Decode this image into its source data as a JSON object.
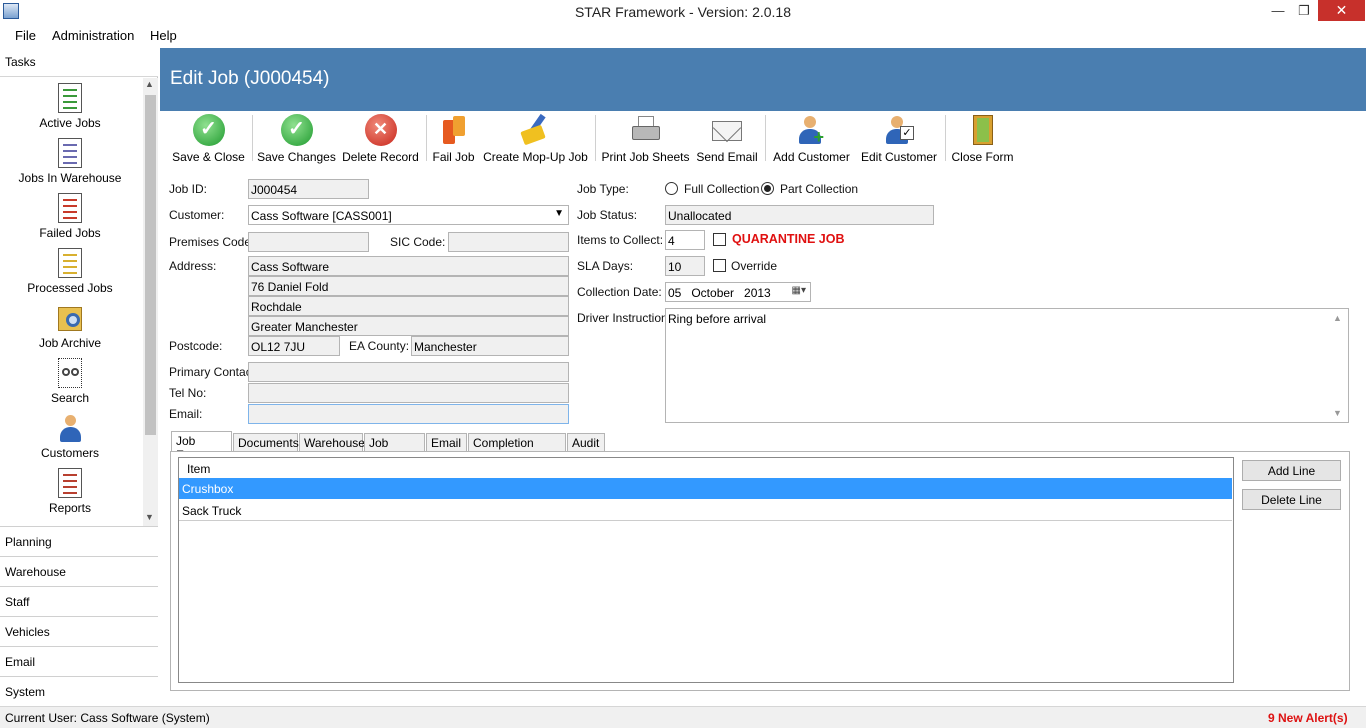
{
  "window": {
    "title": "STAR Framework - Version: 2.0.18",
    "minimize": "—",
    "maximize": "❐",
    "close": "✕"
  },
  "menu": {
    "file": "File",
    "administration": "Administration",
    "help": "Help"
  },
  "sidebar": {
    "tasks_header": "Tasks",
    "items": [
      {
        "label": "Active Jobs",
        "icon": "active-jobs-icon"
      },
      {
        "label": "Jobs In Warehouse",
        "icon": "jobs-warehouse-icon"
      },
      {
        "label": "Failed Jobs",
        "icon": "failed-jobs-icon"
      },
      {
        "label": "Processed Jobs",
        "icon": "processed-jobs-icon"
      },
      {
        "label": "Job Archive",
        "icon": "job-archive-icon"
      },
      {
        "label": "Search",
        "icon": "search-icon"
      },
      {
        "label": "Customers",
        "icon": "customers-icon"
      },
      {
        "label": "Reports",
        "icon": "reports-icon"
      }
    ],
    "nav": [
      "Planning",
      "Warehouse",
      "Staff",
      "Vehicles",
      "Email",
      "System"
    ]
  },
  "form": {
    "title": "Edit Job (J000454)"
  },
  "toolbar": [
    {
      "label": "Save & Close",
      "icon": "save-close-icon"
    },
    {
      "label": "Save Changes",
      "icon": "save-changes-icon"
    },
    {
      "label": "Delete Record",
      "icon": "delete-record-icon"
    },
    {
      "label": "Fail Job",
      "icon": "fail-job-icon"
    },
    {
      "label": "Create Mop-Up Job",
      "icon": "mop-up-icon"
    },
    {
      "label": "Print Job Sheets",
      "icon": "printer-icon"
    },
    {
      "label": "Send Email",
      "icon": "envelope-icon"
    },
    {
      "label": "Add Customer",
      "icon": "add-customer-icon"
    },
    {
      "label": "Edit Customer",
      "icon": "edit-customer-icon"
    },
    {
      "label": "Close Form",
      "icon": "close-form-icon"
    }
  ],
  "fields": {
    "job_id": {
      "label": "Job ID:",
      "value": "J000454"
    },
    "customer": {
      "label": "Customer:",
      "value": "Cass Software [CASS001]"
    },
    "premises_code": {
      "label": "Premises Code:",
      "value": ""
    },
    "sic_code": {
      "label": "SIC Code:",
      "value": ""
    },
    "address": {
      "label": "Address:",
      "lines": [
        "Cass Software",
        "76 Daniel Fold",
        "Rochdale",
        "Greater Manchester"
      ]
    },
    "postcode": {
      "label": "Postcode:",
      "value": "OL12 7JU"
    },
    "ea_county": {
      "label": "EA County:",
      "value": "Manchester"
    },
    "primary_contact": {
      "label": "Primary Contact:",
      "value": ""
    },
    "tel_no": {
      "label": "Tel No:",
      "value": ""
    },
    "email": {
      "label": "Email:",
      "value": ""
    },
    "job_type": {
      "label": "Job Type:",
      "options": [
        "Full Collection",
        "Part Collection"
      ],
      "selected": "Part Collection"
    },
    "job_status": {
      "label": "Job Status:",
      "value": "Unallocated"
    },
    "items_to_collect": {
      "label": "Items to Collect:",
      "value": "4"
    },
    "quarantine": {
      "label": "QUARANTINE JOB",
      "checked": false,
      "color": "#e01010"
    },
    "sla_days": {
      "label": "SLA Days:",
      "value": "10"
    },
    "override": {
      "label": "Override",
      "checked": false
    },
    "collection_date": {
      "label": "Collection Date:",
      "value": "05   October   2013"
    },
    "driver_instruction": {
      "label": "Driver Instruction:",
      "value": "Ring before arrival"
    }
  },
  "tabs": [
    "Job Extras",
    "Documents",
    "Warehouse",
    "Job Notes",
    "Email",
    "Completion Details",
    "Audit"
  ],
  "active_tab": "Job Extras",
  "grid": {
    "column": "Item",
    "rows": [
      "Crushbox",
      "Sack Truck"
    ],
    "selected_row": "Crushbox",
    "selection_color": "#3399ff"
  },
  "grid_buttons": {
    "add": "Add Line",
    "delete": "Delete Line"
  },
  "status": {
    "current_user": "Current User: Cass Software (System)",
    "alerts": "9 New Alert(s)"
  },
  "colors": {
    "header": "#4a7eb0"
  }
}
